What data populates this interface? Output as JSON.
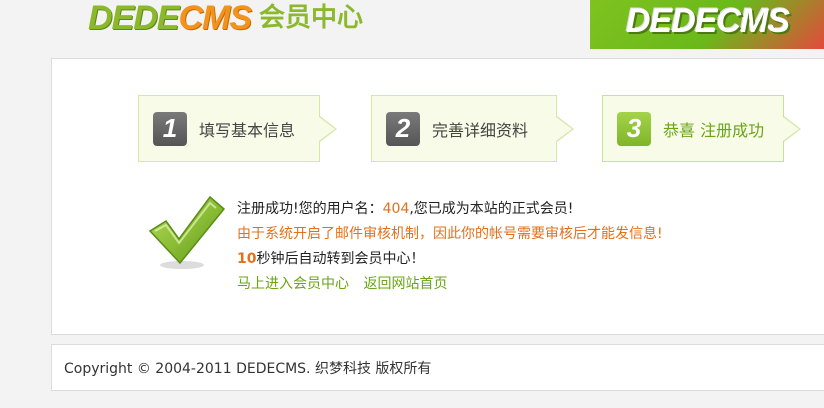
{
  "header": {
    "logo_part1": "DEDE",
    "logo_part2": "CMS",
    "logo_sub": "会员中心",
    "banner_text": "DEDECMS"
  },
  "steps": [
    {
      "number": "1",
      "label": "填写基本信息"
    },
    {
      "number": "2",
      "label": "完善详细资料"
    },
    {
      "number": "3",
      "label": "恭喜 注册成功"
    }
  ],
  "message": {
    "line1_prefix": "注册成功!您的用户名：",
    "username": "404",
    "line1_suffix": ",您已成为本站的正式会员!",
    "line2": "由于系统开启了邮件审核机制，因此你的帐号需要审核后才能发信息!",
    "countdown": "10",
    "line3_suffix": "秒钟后自动转到会员中心！",
    "link_member_center": "马上进入会员中心",
    "link_home": "返回网站首页"
  },
  "footer": {
    "copyright": "Copyright © 2004-2011 DEDECMS. 织梦科技 版权所有"
  },
  "colors": {
    "brand_green": "#8cb92c",
    "brand_orange": "#f3931e",
    "link_green": "#6aa514",
    "highlight_orange": "#e4701b"
  }
}
